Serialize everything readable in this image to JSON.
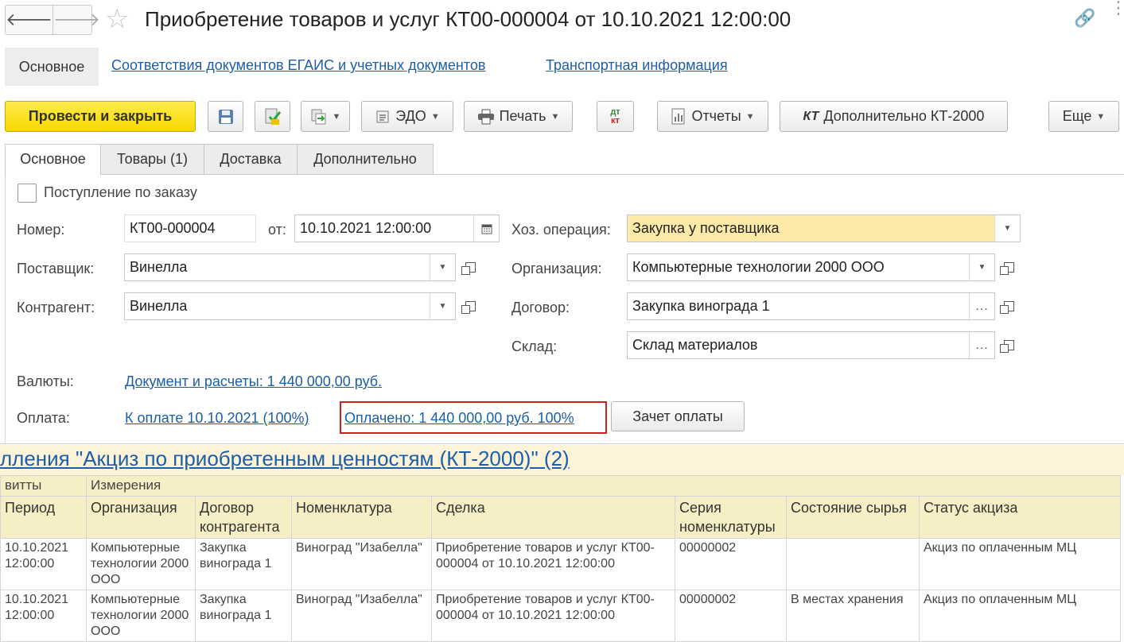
{
  "window": {
    "title": "Приобретение товаров и услуг КТ00-000004 от 10.10.2021 12:00:00",
    "back": "🡐",
    "forward": "🡒"
  },
  "sections": {
    "main": "Основное",
    "egais": "Соответствия документов ЕГАИС и учетных документов",
    "transport": "Транспортная информация"
  },
  "toolbar": {
    "post_close": "Провести и закрыть",
    "edo": "ЭДО",
    "print": "Печать",
    "reports": "Отчеты",
    "extra_kt": "Дополнительно КТ-2000",
    "more": "Еще",
    "dtkt_top": "дт",
    "dtkt_bottom": "кт"
  },
  "tabs": [
    "Основное",
    "Товары (1)",
    "Доставка",
    "Дополнительно"
  ],
  "form": {
    "by_order_label": "Поступление по заказу",
    "number_label": "Номер:",
    "number_value": "КТ00-000004",
    "from_label": "от:",
    "date_value": "10.10.2021 12:00:00",
    "operation_label": "Хоз. операция:",
    "operation_value": "Закупка у поставщика",
    "supplier_label": "Поставщик:",
    "supplier_value": "Винелла",
    "org_label": "Организация:",
    "org_value": "Компьютерные технологии 2000 ООО",
    "counterparty_label": "Контрагент:",
    "counterparty_value": "Винелла",
    "contract_label": "Договор:",
    "contract_value": "Закупка винограда 1",
    "warehouse_label": "Склад:",
    "warehouse_value": "Склад материалов",
    "currency_label": "Валюты:",
    "currency_link": "Документ и расчеты: 1 440 000,00 руб.",
    "payment_label": "Оплата:",
    "payment_link": "К оплате 10.10.2021 (100%)",
    "paid_link": "Оплачено: 1 440 000,00 руб. 100%",
    "offset_button": "Зачет оплаты",
    "ellipsis": "..."
  },
  "register": {
    "title": "лления \"Акциз по приобретенным ценностям (КТ-2000)\" (2)",
    "group_left": "витты",
    "group_dims": "Измерения",
    "columns": [
      "Период",
      "Организация",
      "Договор контрагента",
      "Номенклатура",
      "Сделка",
      "Серия номенклатуры",
      "Состояние сырья",
      "Статус акциза"
    ],
    "rows": [
      [
        "10.10.2021 12:00:00",
        "Компьютерные технологии 2000 ООО",
        "Закупка винограда 1",
        "Виноград \"Изабелла\"",
        "Приобретение товаров и услуг КТ00-000004 от 10.10.2021 12:00:00",
        "00000002",
        "",
        "Акциз по оплаченным МЦ"
      ],
      [
        "10.10.2021 12:00:00",
        "Компьютерные технологии 2000 ООО",
        "Закупка винограда 1",
        "Виноград \"Изабелла\"",
        "Приобретение товаров и услуг КТ00-000004 от 10.10.2021 12:00:00",
        "00000002",
        "В местах хранения",
        "Акциз по оплаченным МЦ"
      ]
    ]
  },
  "colors": {
    "primary_button": "#f5d800",
    "link": "#1c5ea8",
    "highlight_border": "#d11e1e",
    "operation_field": "#fde9a8",
    "table_header": "#f6efc6"
  }
}
